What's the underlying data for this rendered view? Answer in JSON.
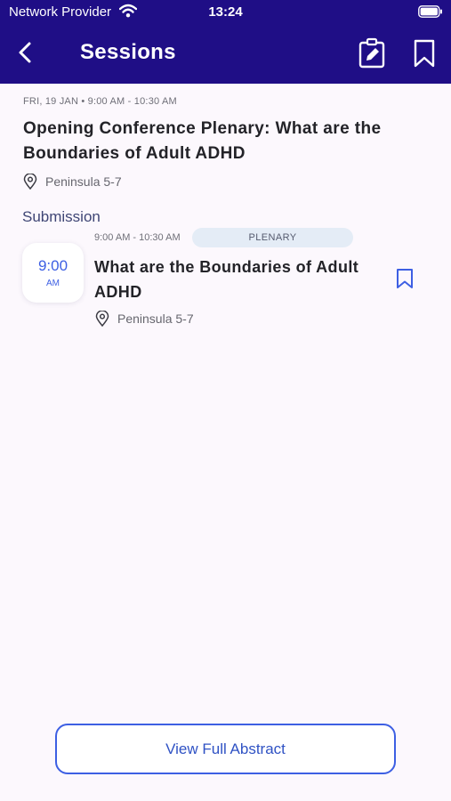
{
  "status_bar": {
    "carrier": "Network Provider",
    "time": "13:24"
  },
  "nav": {
    "title": "Sessions",
    "icons": [
      "chevron-left-icon",
      "edit-note-icon",
      "bookmark-icon"
    ]
  },
  "session": {
    "date_time": "FRI, 19 JAN • 9:00 AM - 10:30 AM",
    "title": "Opening Conference Plenary: What are the Boundaries of Adult ADHD",
    "location": "Peninsula 5-7"
  },
  "submission_section": {
    "heading": "Submission",
    "item": {
      "start_time": "9:00",
      "am_pm": "AM",
      "time_range": "9:00 AM - 10:30 AM",
      "tag": "PLENARY",
      "title": "What are the Boundaries of Adult ADHD",
      "location": "Peninsula 5-7"
    }
  },
  "footer": {
    "button_label": "View Full Abstract"
  },
  "colors": {
    "header_bg": "#1f0e86",
    "accent": "#3d5fe3",
    "background": "#fcf8fd",
    "pill_bg": "#e4ecf6"
  }
}
